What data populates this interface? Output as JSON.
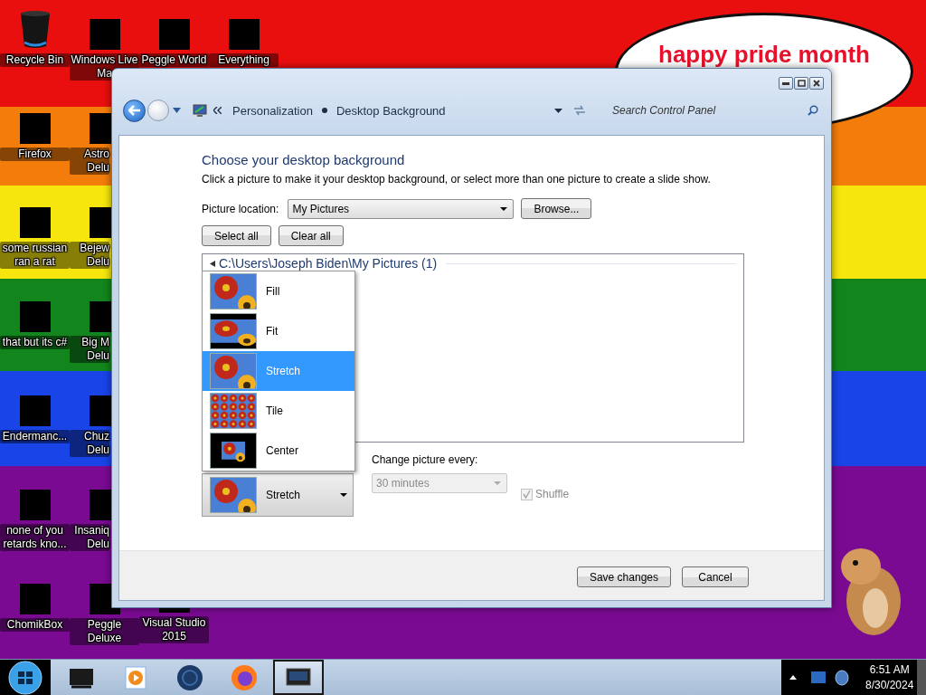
{
  "desktop": {
    "wallpaper_text": "happy pride month",
    "icon_columns": [
      [
        {
          "label": "Recycle Bin",
          "kind": "trash"
        },
        {
          "label": "Firefox",
          "kind": "covered"
        },
        {
          "label": "some russian ran a rat",
          "kind": "covered"
        },
        {
          "label": "that but its c#",
          "kind": "covered"
        },
        {
          "label": "Endermanc...",
          "kind": "covered"
        },
        {
          "label": "none of you retards kno...",
          "kind": "covered"
        },
        {
          "label": "ChomikBox",
          "kind": "covered"
        }
      ],
      [
        {
          "label": "Windows Live Ma",
          "kind": "covered"
        },
        {
          "label": "Astro Delu",
          "kind": "covered"
        },
        {
          "label": "Bejew Delu",
          "kind": "covered"
        },
        {
          "label": "Big M Delu",
          "kind": "covered"
        },
        {
          "label": "Chuz Delu",
          "kind": "covered"
        },
        {
          "label": "Insaniq Delu",
          "kind": "covered"
        },
        {
          "label": "Peggle Deluxe",
          "kind": "covered"
        }
      ],
      [
        {
          "label": "Peggle World",
          "kind": "covered"
        },
        {
          "label": "Visual Studio 2015",
          "kind": "covered"
        }
      ],
      [
        {
          "label": "Everything",
          "kind": "covered"
        }
      ]
    ]
  },
  "window": {
    "nav": {
      "breadcrumbs": [
        "Personalization",
        "Desktop Background"
      ],
      "search_placeholder": "Search Control Panel"
    },
    "heading": "Choose your desktop background",
    "description": "Click a picture to make it your desktop background, or select more than one picture to create a slide show.",
    "location": {
      "label": "Picture location:",
      "value": "My Pictures"
    },
    "browse_button": "Browse...",
    "select_buttons": [
      "Select all",
      "Clear all"
    ],
    "group_header": "C:\\Users\\Joseph Biden\\My Pictures (1)",
    "position_menu": [
      {
        "label": "Fill",
        "kind": "fill",
        "selected": false
      },
      {
        "label": "Fit",
        "kind": "fit",
        "selected": false
      },
      {
        "label": "Stretch",
        "kind": "stretch",
        "selected": true
      },
      {
        "label": "Tile",
        "kind": "tile",
        "selected": false
      },
      {
        "label": "Center",
        "kind": "center",
        "selected": false
      }
    ],
    "position": {
      "value": "Stretch",
      "kind": "stretch"
    },
    "interval": {
      "label": "Change picture every:",
      "value": "30 minutes",
      "disabled": true
    },
    "shuffle": {
      "label": "Shuffle",
      "checked": true,
      "disabled": true
    },
    "buttons": [
      "Save changes",
      "Cancel"
    ]
  },
  "taskbar": {
    "apps": [
      {
        "kind": "monitor",
        "active": false
      },
      {
        "kind": "media",
        "active": false
      },
      {
        "kind": "globe",
        "active": false
      },
      {
        "kind": "browser",
        "active": false
      },
      {
        "kind": "screen",
        "active": true
      }
    ],
    "time": "6:51 AM",
    "date": "8/30/2024"
  }
}
